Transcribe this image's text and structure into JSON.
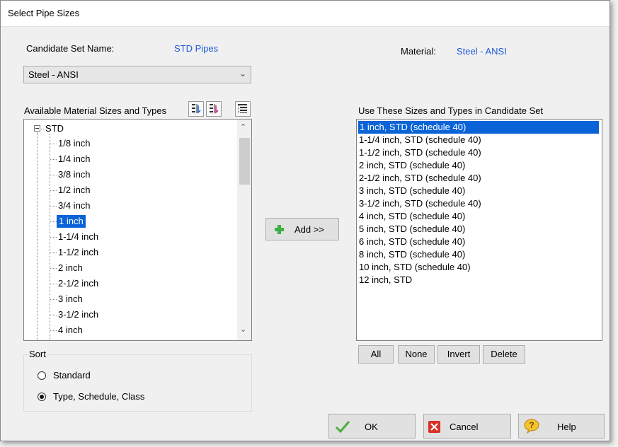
{
  "title": "Select Pipe Sizes",
  "candidate_set": {
    "label": "Candidate Set Name:",
    "value": "STD Pipes"
  },
  "material": {
    "label": "Material:",
    "value": "Steel - ANSI"
  },
  "material_combo": {
    "value": "Steel - ANSI"
  },
  "available": {
    "label": "Available Material Sizes and Types",
    "root": "STD",
    "items": [
      "1/8 inch",
      "1/4 inch",
      "3/8 inch",
      "1/2 inch",
      "3/4 inch",
      "1 inch",
      "1-1/4 inch",
      "1-1/2 inch",
      "2 inch",
      "2-1/2 inch",
      "3 inch",
      "3-1/2 inch",
      "4 inch"
    ],
    "selected": "1 inch"
  },
  "add_button": "Add >>",
  "use": {
    "label": "Use These Sizes and Types in Candidate Set",
    "items": [
      "1 inch, STD (schedule 40)",
      "1-1/4 inch, STD (schedule 40)",
      "1-1/2 inch, STD (schedule 40)",
      "2 inch, STD (schedule 40)",
      "2-1/2 inch, STD (schedule 40)",
      "3 inch, STD (schedule 40)",
      "3-1/2 inch, STD (schedule 40)",
      "4 inch, STD (schedule 40)",
      "5 inch, STD (schedule 40)",
      "6 inch, STD (schedule 40)",
      "8 inch, STD (schedule 40)",
      "10 inch, STD (schedule 40)",
      "12 inch, STD"
    ],
    "selected": "1 inch, STD (schedule 40)"
  },
  "list_buttons": {
    "all": "All",
    "none": "None",
    "invert": "Invert",
    "delete": "Delete"
  },
  "sort": {
    "label": "Sort",
    "options": [
      "Standard",
      "Type, Schedule, Class"
    ],
    "selected": "Type, Schedule, Class"
  },
  "footer": {
    "ok": "OK",
    "cancel": "Cancel",
    "help": "Help"
  },
  "icons": {
    "tree_buttons": [
      "expand-all-icon",
      "collapse-sort-icon",
      "tree-options-icon"
    ],
    "add": "plus-icon",
    "ok": "checkmark-icon",
    "cancel": "x-icon",
    "help": "help-bubble-icon"
  }
}
